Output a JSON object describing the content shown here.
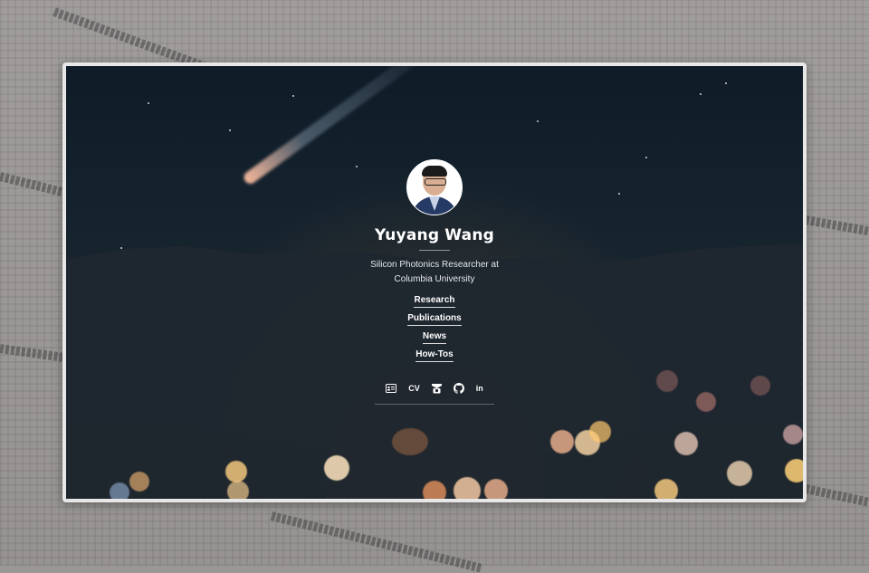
{
  "profile": {
    "name": "Yuyang Wang",
    "subtitle_line1": "Silicon Photonics Researcher at",
    "subtitle_line2": "Columbia University"
  },
  "nav": {
    "items": [
      "Research",
      "Publications",
      "News",
      "How-Tos"
    ]
  },
  "social": {
    "cv_label": "CV",
    "linkedin_label": "in",
    "icons": [
      "id-card-icon",
      "cv-link",
      "scholar-icon",
      "github-icon",
      "linkedin-icon"
    ]
  },
  "colors": {
    "accent_text": "#ffffff",
    "frame_border": "#e7e7e7",
    "backdrop": "#9a9796"
  }
}
